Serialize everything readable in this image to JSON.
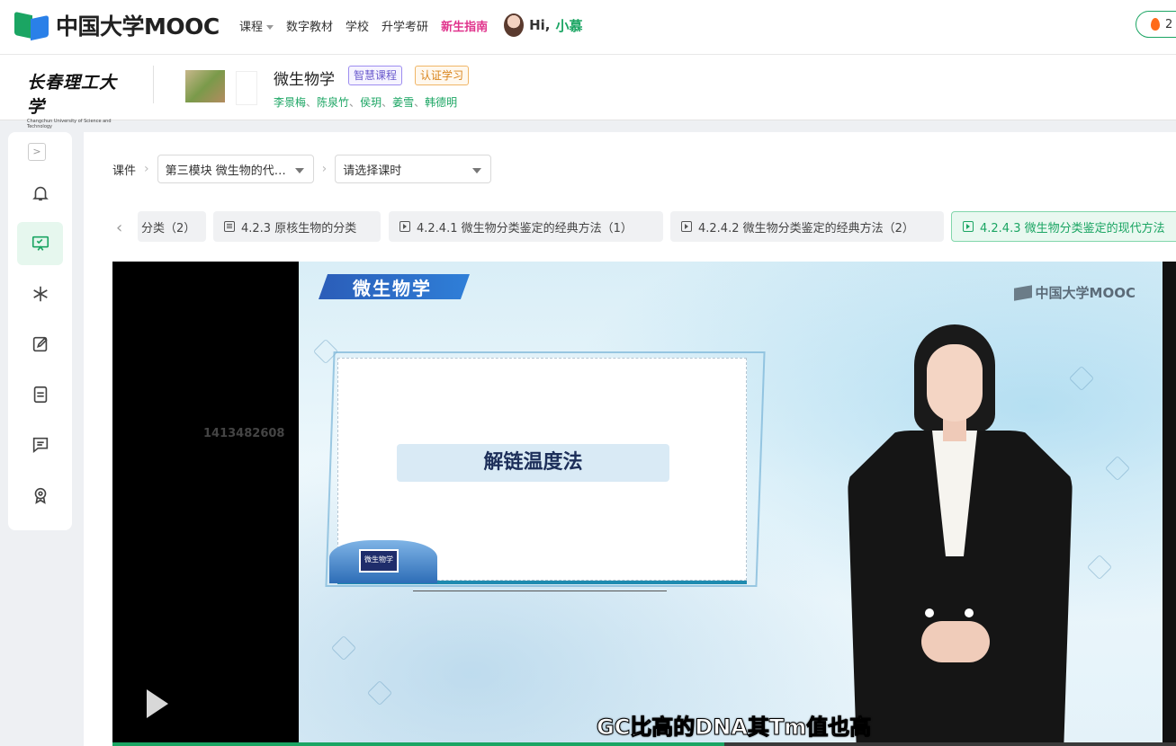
{
  "topnav": {
    "logo_text": "中国大学MOOC",
    "items": [
      "课程",
      "数字教材",
      "学校",
      "升学考研",
      "新生指南"
    ],
    "greeting_hi": "Hi,",
    "greeting_name": "小慕",
    "right_count": "2"
  },
  "course": {
    "school": "长春理工大学",
    "school_en": "Changchun University of Science and Technology",
    "title": "微生物学",
    "tag_smart": "智慧课程",
    "tag_cert": "认证学习",
    "teachers": [
      "李景梅",
      "陈泉竹",
      "侯玥",
      "姜雪",
      "韩德明"
    ],
    "teacher_sep": "、"
  },
  "breadcrumb": {
    "root": "课件",
    "module": "第三模块 微生物的代…",
    "lesson_placeholder": "请选择课时"
  },
  "lesson_tabs": [
    {
      "label": "分类（2）",
      "icon": "none",
      "active": false
    },
    {
      "label": "4.2.3 原核生物的分类",
      "icon": "doc",
      "active": false
    },
    {
      "label": "4.2.4.1 微生物分类鉴定的经典方法（1）",
      "icon": "play",
      "active": false
    },
    {
      "label": "4.2.4.2 微生物分类鉴定的经典方法（2）",
      "icon": "play",
      "active": false
    },
    {
      "label": "4.2.4.3 微生物分类鉴定的现代方法",
      "icon": "play",
      "active": true
    }
  ],
  "video": {
    "watermark_id": "1413482608",
    "stage_title": "微生物学",
    "stage_brand": "中国大学MOOC",
    "slide_label": "解链温度法",
    "badge_text": "微生物学",
    "subtitle": "GC比高的DNA其Tm值也高",
    "progress_fraction": 0.575
  },
  "sidebar_icons": [
    "bell-icon",
    "courseware-icon",
    "snowflake-icon",
    "edit-icon",
    "document-icon",
    "chat-icon",
    "certificate-icon"
  ],
  "colors": {
    "brand_green": "#1ba563",
    "brand_blue": "#2a80e8",
    "nav_highlight": "#e0338c",
    "tag_smart": "#6a5acd",
    "tag_cert": "#d9841c"
  }
}
